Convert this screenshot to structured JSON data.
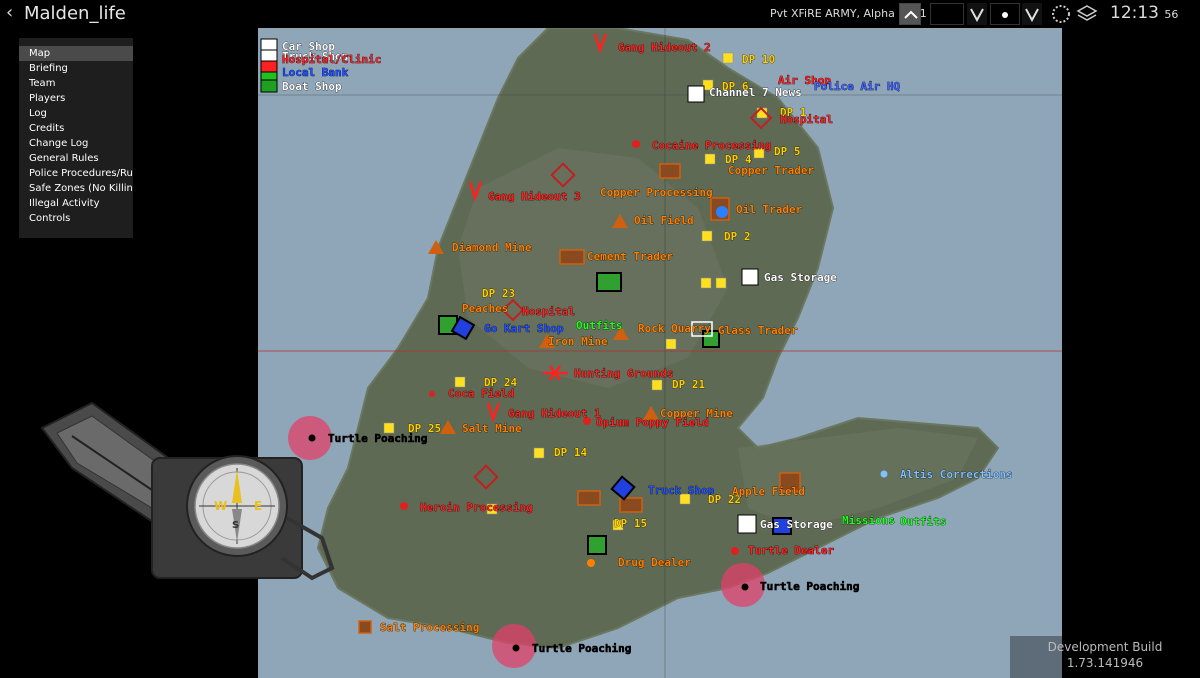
{
  "window": {
    "title": "Malden_life"
  },
  "top_bar": {
    "unit": "Pvt XFiRE ARMY, Alpha 1-1 1",
    "time_hm": "12:13",
    "time_s": "56"
  },
  "menu": {
    "items": [
      "Map",
      "Briefing",
      "Team",
      "Players",
      "Log",
      "Credits",
      "Change Log",
      "General Rules",
      "Police Procedures/Rules",
      "Safe Zones (No Killing)",
      "Illegal Activity",
      "Controls"
    ],
    "selected": 0
  },
  "map_legend": [
    {
      "label": "Car Shop",
      "color": "#ffffff"
    },
    {
      "label": "Truck Shop",
      "color": "#ffffff"
    },
    {
      "label": "Hospital/Clinic",
      "color": "#ff2020"
    },
    {
      "label": "Local Bank",
      "color": "#2050ff"
    },
    {
      "label": "Boat Shop",
      "color": "#ffffff"
    }
  ],
  "map_labels": [
    {
      "t": "Gang Hideout 2",
      "c": "#ff2020"
    },
    {
      "t": "DP 10",
      "c": "#ffd000"
    },
    {
      "t": "DP 6",
      "c": "#ffd000"
    },
    {
      "t": "Air Shop",
      "c": "#ff2020"
    },
    {
      "t": "Police Air HQ",
      "c": "#4060ff"
    },
    {
      "t": "Channel 7 News",
      "c": "#ffffff"
    },
    {
      "t": "DP 1",
      "c": "#ffd000"
    },
    {
      "t": "Hospital",
      "c": "#ff2020"
    },
    {
      "t": "Cocaine Processing",
      "c": "#ff2020"
    },
    {
      "t": "DP 5",
      "c": "#ffd000"
    },
    {
      "t": "DP 4",
      "c": "#ffd000"
    },
    {
      "t": "Copper Trader",
      "c": "#ff8000"
    },
    {
      "t": "Copper Processing",
      "c": "#ff8000"
    },
    {
      "t": "Gang Hideout 3",
      "c": "#ff2020"
    },
    {
      "t": "Oil Field",
      "c": "#ff8000"
    },
    {
      "t": "Oil Trader",
      "c": "#ff8000"
    },
    {
      "t": "DP 2",
      "c": "#ffd000"
    },
    {
      "t": "Diamond Mine",
      "c": "#ff8000"
    },
    {
      "t": "Cement Trader",
      "c": "#ff8000"
    },
    {
      "t": "Gas Storage",
      "c": "#ffffff"
    },
    {
      "t": "DP 23",
      "c": "#ffd000"
    },
    {
      "t": "Peaches",
      "c": "#ff8000"
    },
    {
      "t": "Hospital",
      "c": "#ff2020"
    },
    {
      "t": "Go Kart Shop",
      "c": "#2050ff"
    },
    {
      "t": "Outfits",
      "c": "#20ff20"
    },
    {
      "t": "Rock Quarry",
      "c": "#ff8000"
    },
    {
      "t": "Glass Trader",
      "c": "#ff8000"
    },
    {
      "t": "Iron Mine",
      "c": "#ff8000"
    },
    {
      "t": "Hunting Grounds",
      "c": "#ff2020"
    },
    {
      "t": "DP 21",
      "c": "#ffd000"
    },
    {
      "t": "DP 24",
      "c": "#ffd000"
    },
    {
      "t": "Coca Field",
      "c": "#ff2020"
    },
    {
      "t": "Gang Hideout 1",
      "c": "#ff2020"
    },
    {
      "t": "Copper Mine",
      "c": "#ff8000"
    },
    {
      "t": "Turtle Poaching",
      "c": "#000000"
    },
    {
      "t": "DP 25",
      "c": "#ffd000"
    },
    {
      "t": "Salt Mine",
      "c": "#ff8000"
    },
    {
      "t": "Opium Poppy Field",
      "c": "#ff2020"
    },
    {
      "t": "DP 14",
      "c": "#ffd000"
    },
    {
      "t": "Altis Corrections",
      "c": "#80c0ff"
    },
    {
      "t": "Truck Shop",
      "c": "#2050ff"
    },
    {
      "t": "DP 22",
      "c": "#ffd000"
    },
    {
      "t": "Apple Field",
      "c": "#ff8000"
    },
    {
      "t": "Heroin Processing",
      "c": "#ff2020"
    },
    {
      "t": "DP 15",
      "c": "#ffd000"
    },
    {
      "t": "Gas Storage",
      "c": "#ffffff"
    },
    {
      "t": "Missions",
      "c": "#20ff20"
    },
    {
      "t": "Outfits",
      "c": "#20ff20"
    },
    {
      "t": "Turtle Dealer",
      "c": "#ff2020"
    },
    {
      "t": "Drug Dealer",
      "c": "#ff8000"
    },
    {
      "t": "Turtle Poaching",
      "c": "#000000"
    },
    {
      "t": "Salt Processing",
      "c": "#ff8000"
    },
    {
      "t": "Turtle Poaching",
      "c": "#000000"
    }
  ],
  "dev_build": {
    "line1": "Development Build",
    "line2": "1.73.141946"
  }
}
